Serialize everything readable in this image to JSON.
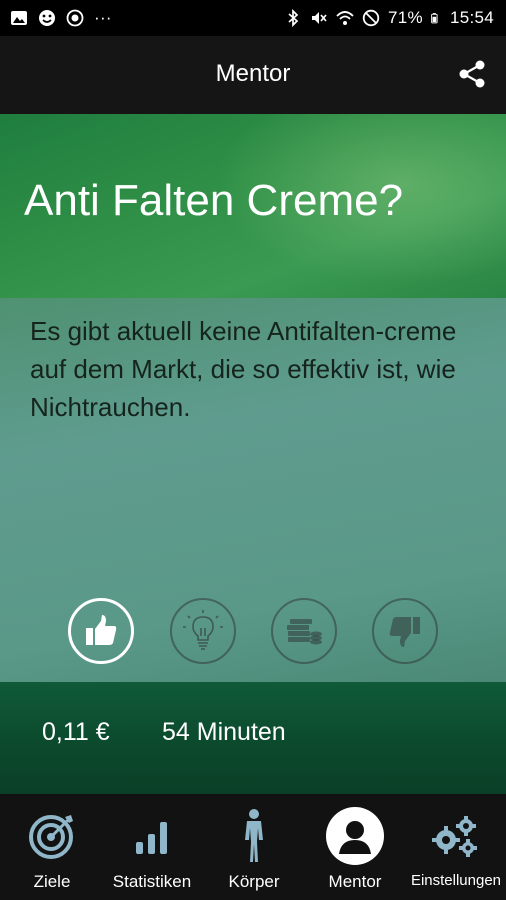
{
  "status_bar": {
    "battery": "71%",
    "time": "15:54",
    "left_icons": [
      "image-icon",
      "face-icon",
      "record-icon",
      "more-dots-icon"
    ],
    "right_icons": [
      "bluetooth-icon",
      "mute-icon",
      "wifi-icon",
      "dnd-icon",
      "battery-icon"
    ]
  },
  "app_bar": {
    "title": "Mentor",
    "share_icon": "share-icon"
  },
  "tip": {
    "title": "Anti Falten Creme?",
    "body": "Es gibt aktuell keine Antifalten-creme auf dem Markt, die so effektiv ist, wie Nichtrauchen."
  },
  "actions": [
    {
      "name": "thumbs-up-icon",
      "active": true
    },
    {
      "name": "lightbulb-icon",
      "active": false
    },
    {
      "name": "money-icon",
      "active": false
    },
    {
      "name": "thumbs-down-icon",
      "active": false
    }
  ],
  "stats": {
    "money": "0,11 €",
    "time": "54 Minuten"
  },
  "nav": {
    "items": [
      {
        "label": "Ziele",
        "icon": "target-icon"
      },
      {
        "label": "Statistiken",
        "icon": "bar-chart-icon"
      },
      {
        "label": "Körper",
        "icon": "body-icon"
      },
      {
        "label": "Mentor",
        "icon": "mentor-icon",
        "selected": true
      },
      {
        "label": "Einstellungen",
        "icon": "gears-icon"
      }
    ]
  },
  "colors": {
    "header_green": "#2f8f46",
    "stats_band": "#0c4a2d",
    "nav_bg": "#121212",
    "app_bar_bg": "#151515"
  }
}
